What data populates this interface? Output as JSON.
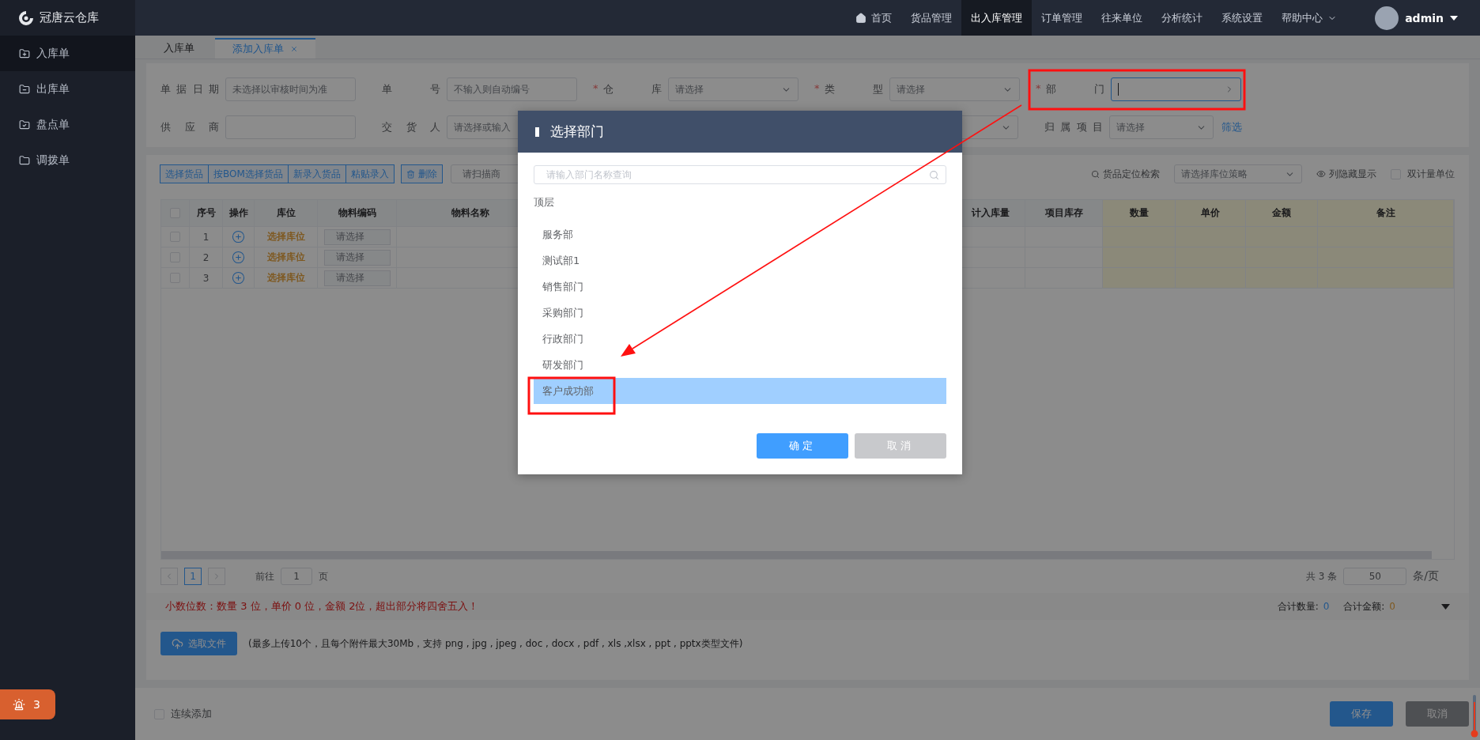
{
  "app": {
    "name": "冠唐云仓库"
  },
  "nav": [
    {
      "label": "首页",
      "selected": false,
      "kind": "home"
    },
    {
      "label": "货品管理",
      "selected": false,
      "kind": "plain"
    },
    {
      "label": "出入库管理",
      "selected": true,
      "kind": "plain"
    },
    {
      "label": "订单管理",
      "selected": false,
      "kind": "plain"
    },
    {
      "label": "往来单位",
      "selected": false,
      "kind": "plain"
    },
    {
      "label": "分析统计",
      "selected": false,
      "kind": "plain"
    },
    {
      "label": "系统设置",
      "selected": false,
      "kind": "plain"
    },
    {
      "label": "帮助中心",
      "selected": false,
      "kind": "dropdown"
    }
  ],
  "user": {
    "name": "admin"
  },
  "sidebar": {
    "items": [
      {
        "label": "入库单",
        "selected": true,
        "kind": "in"
      },
      {
        "label": "出库单",
        "selected": false,
        "kind": "out"
      },
      {
        "label": "盘点单",
        "selected": false,
        "kind": "check"
      },
      {
        "label": "调拨单",
        "selected": false,
        "kind": "transfer"
      }
    ]
  },
  "alert_badge": {
    "count": "3"
  },
  "tabs": [
    {
      "label": "入库单",
      "selected": false,
      "closable": false
    },
    {
      "label": "添加入库单",
      "selected": true,
      "closable": true
    }
  ],
  "form": {
    "fields": [
      {
        "label": "单据日期",
        "kind": "input",
        "placeholder": "未选择以审核时间为准"
      },
      {
        "label": "单号",
        "kind": "input",
        "placeholder": "不输入则自动编号"
      },
      {
        "label": "仓库",
        "required_mark": "*",
        "kind": "select",
        "placeholder": "请选择"
      },
      {
        "label": "类型",
        "required_mark": "*",
        "kind": "select",
        "placeholder": "请选择"
      },
      {
        "label": "部门",
        "required_mark": "*",
        "kind": "cascader",
        "focused": true
      },
      {
        "label": "供应商",
        "kind": "input"
      },
      {
        "label": "交货人",
        "kind": "input",
        "placeholder": "请选择或输入"
      },
      {
        "kind": "wide-select"
      },
      {
        "label": "归属项目",
        "kind": "short-select",
        "placeholder": "请选择",
        "link": "筛选"
      }
    ]
  },
  "toolbar": {
    "buttons": [
      "选择货品",
      "按BOM选择货品",
      "新录入货品",
      "粘贴录入"
    ],
    "delete_button": "删除",
    "scan_placeholder": "请扫描商",
    "locate_label": "货品定位检索",
    "strategy_placeholder": "请选择库位策略",
    "columns_toggle": "列隐藏显示",
    "dual_unit": {
      "label": "双计量单位",
      "checked": false
    }
  },
  "table": {
    "all_checked": false,
    "columns": [
      {
        "label": "序号",
        "editable": false
      },
      {
        "label": "操作",
        "editable": false
      },
      {
        "label": "库位",
        "editable": false
      },
      {
        "label": "物料编码",
        "editable": false
      },
      {
        "label": "物料名称",
        "editable": false
      },
      {
        "label": "计入库量",
        "editable": false
      },
      {
        "label": "项目库存",
        "editable": false
      },
      {
        "label": "数量",
        "editable": true
      },
      {
        "label": "单价",
        "editable": true
      },
      {
        "label": "金额",
        "editable": true
      },
      {
        "label": "备注",
        "editable": true
      }
    ],
    "rows": [
      {
        "no": "1",
        "location": "选择库位",
        "code_placeholder": "请选择",
        "checked": false
      },
      {
        "no": "2",
        "location": "选择库位",
        "code_placeholder": "请选择",
        "checked": false
      },
      {
        "no": "3",
        "location": "选择库位",
        "code_placeholder": "请选择",
        "checked": false
      }
    ]
  },
  "pagination": {
    "page": "1",
    "goto_label": "前往",
    "goto_value": "1",
    "page_suffix": "页",
    "total": "共 3 条",
    "page_size": "50",
    "page_size_suffix": "条/页"
  },
  "notice": "小数位数：数量 3 位，单价 0 位，金额 2位，超出部分将四舍五入！",
  "totals": [
    {
      "label": "合计数量:",
      "value": "0",
      "kind": "quantity"
    },
    {
      "label": "合计金额:",
      "value": "0",
      "kind": "amount"
    }
  ],
  "upload": {
    "button": "选取文件",
    "hint": "(最多上传10个，且每个附件最大30Mb，支持 png , jpg , jpeg , doc , docx , pdf , xls ,xlsx , ppt , pptx类型文件)"
  },
  "footer": {
    "continue": {
      "label": "连续添加",
      "checked": false
    },
    "save": "保存",
    "cancel": {
      "label": "取消",
      "disabled": true
    }
  },
  "dialog": {
    "title": "选择部门",
    "search_placeholder": "请输入部门名称查询",
    "root": "顶层",
    "items": [
      {
        "label": "服务部",
        "selected": false
      },
      {
        "label": "测试部1",
        "selected": false
      },
      {
        "label": "销售部门",
        "selected": false
      },
      {
        "label": "采购部门",
        "selected": false
      },
      {
        "label": "行政部门",
        "selected": false
      },
      {
        "label": "研发部门",
        "selected": false
      },
      {
        "label": "客户成功部",
        "selected": true
      }
    ],
    "confirm": "确定",
    "cancel": "取消"
  }
}
